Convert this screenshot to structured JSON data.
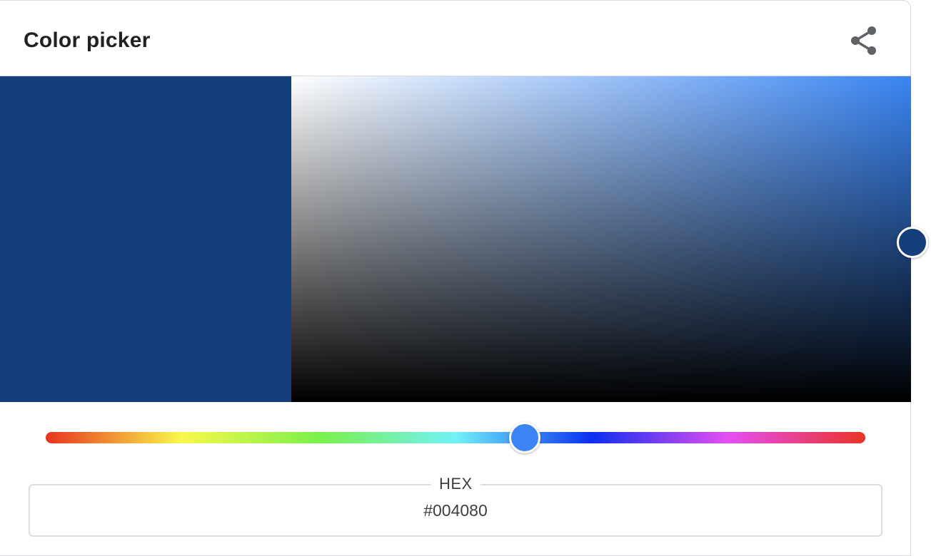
{
  "header": {
    "title": "Color picker",
    "share_icon": "share-icon"
  },
  "picker": {
    "selected_color": "#153f7b",
    "hue_color": "#3a85f3",
    "hue_handle_color": "#3a85f3",
    "hue_position_fraction": 0.589
  },
  "hex": {
    "label": "HEX",
    "value": "#004080"
  },
  "colors": {
    "text_primary": "#202124",
    "border": "#dadce0",
    "icon": "#5f6368"
  }
}
